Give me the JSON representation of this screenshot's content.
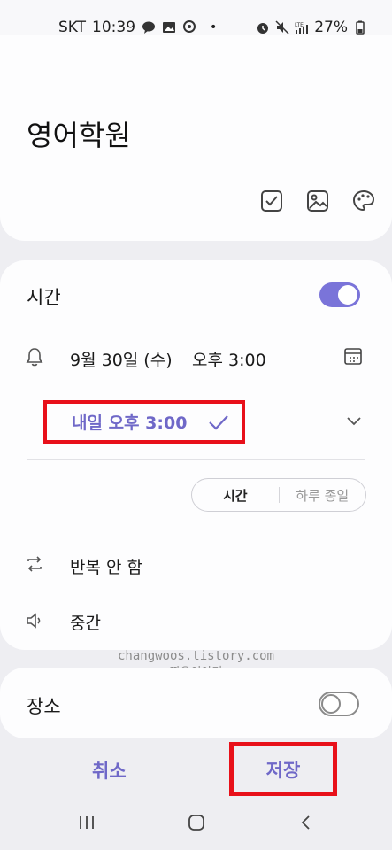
{
  "status_bar": {
    "carrier": "SKT",
    "time": "10:39",
    "battery": "27%",
    "icons": [
      "talk-icon",
      "gallery-icon",
      "location-icon",
      "alarm-icon",
      "mute-icon",
      "lte-signal-icon",
      "battery-icon"
    ]
  },
  "note": {
    "title": "영어학원",
    "tool_icons": [
      "checkbox-icon",
      "image-icon",
      "palette-icon"
    ]
  },
  "time_section": {
    "label": "시간",
    "toggle_on": true,
    "date": "9월 30일 (수)",
    "time": "오후 3:00",
    "reminder": "내일 오후 3:00",
    "mode_options": [
      "시간",
      "하루 종일"
    ],
    "mode_selected": "시간",
    "repeat": "반복 안 함",
    "sound": "중간"
  },
  "watermark": {
    "line1": "changwoos.tistory.com",
    "line2": "짱우이야기"
  },
  "place_section": {
    "label": "장소",
    "toggle_on": false
  },
  "actions": {
    "cancel": "취소",
    "save": "저장"
  },
  "colors": {
    "accent": "#6f68c8",
    "highlight_box": "#e8101a"
  }
}
